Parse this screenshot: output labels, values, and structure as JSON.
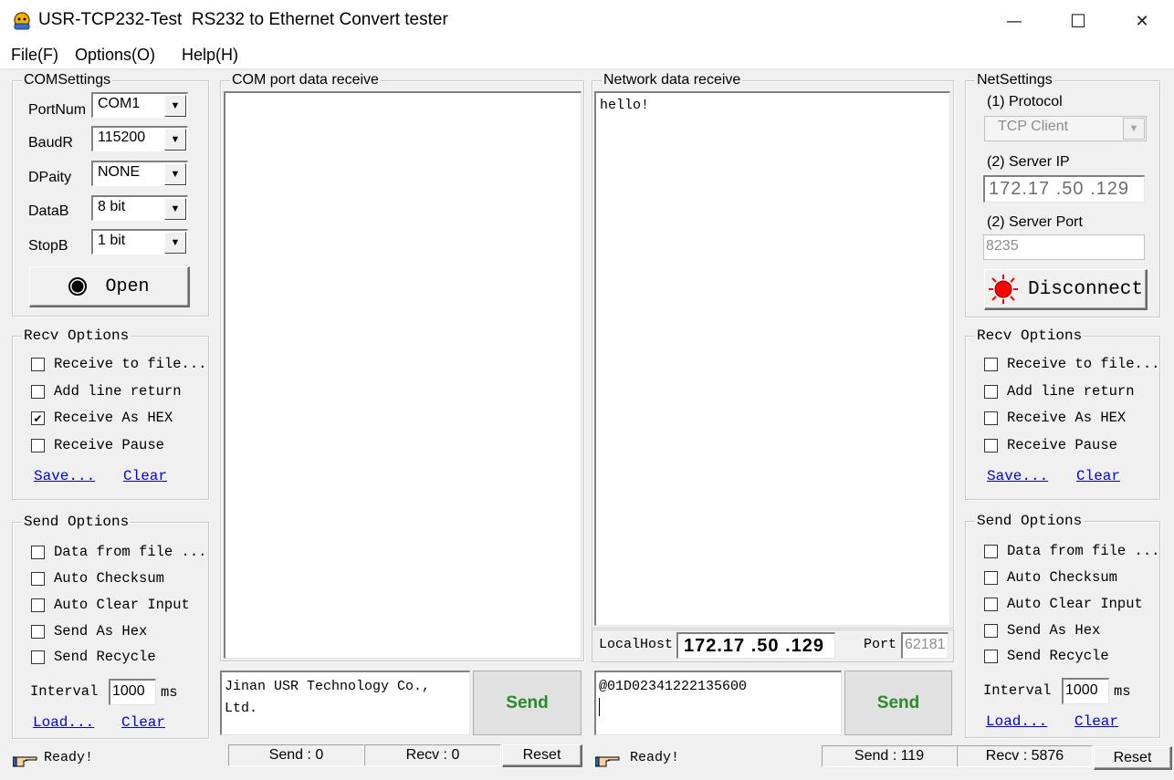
{
  "window": {
    "title": "USR-TCP232-Test  RS232 to Ethernet Convert tester",
    "app_icon": "usr-app-icon",
    "minimize_glyph": "—",
    "maximize_glyph": "☐",
    "close_glyph": "✕"
  },
  "menu": {
    "file": "File(F)",
    "options": "Options(O)",
    "help": "Help(H)"
  },
  "com_settings": {
    "title": "COMSettings",
    "portnum_label": "PortNum",
    "portnum_value": "COM1",
    "baudr_label": "BaudR",
    "baudr_value": "115200",
    "dpaity_label": "DPaity",
    "dpaity_value": "NONE",
    "datab_label": "DataB",
    "datab_value": "8 bit",
    "stopb_label": "StopB",
    "stopb_value": "1 bit",
    "open_button": "Open"
  },
  "left_recv_options": {
    "title": "Recv Options",
    "receive_to_file": "Receive to file...",
    "receive_to_file_checked": false,
    "add_line_return": "Add line return",
    "add_line_return_checked": false,
    "receive_as_hex": "Receive As HEX",
    "receive_as_hex_checked": true,
    "receive_pause": "Receive Pause",
    "receive_pause_checked": false,
    "save_link": "Save...",
    "clear_link": "Clear"
  },
  "left_send_options": {
    "title": "Send Options",
    "data_from_file": "Data from file ...",
    "auto_checksum": "Auto Checksum",
    "auto_clear_input": "Auto Clear Input",
    "send_as_hex": "Send As Hex",
    "send_recycle": "Send Recycle",
    "interval_label": "Interval",
    "interval_value": "1000",
    "interval_unit": "ms",
    "load_link": "Load...",
    "clear_link": "Clear"
  },
  "com_receive": {
    "title": "COM port data receive",
    "content": ""
  },
  "com_send": {
    "input_value": "Jinan USR Technology Co., Ltd.",
    "send_button": "Send"
  },
  "net_receive": {
    "title": "Network data receive",
    "content": "hello!"
  },
  "net_local": {
    "localhost_label": "LocalHost",
    "localhost_value": "172.17 .50 .129",
    "port_label": "Port",
    "port_value": "62181"
  },
  "net_send": {
    "input_value": "@01D02341222135600",
    "send_button": "Send"
  },
  "net_settings": {
    "title": "NetSettings",
    "protocol_label": "(1) Protocol",
    "protocol_value": "TCP Client",
    "server_ip_label": "(2) Server IP",
    "server_ip_value": "172.17 .50 .129",
    "server_port_label": "(2) Server Port",
    "server_port_value": "8235",
    "disconnect_button": "Disconnect"
  },
  "right_recv_options": {
    "title": "Recv Options",
    "receive_to_file": "Receive to file...",
    "add_line_return": "Add line return",
    "receive_as_hex": "Receive As HEX",
    "receive_pause": "Receive Pause",
    "save_link": "Save...",
    "clear_link": "Clear"
  },
  "right_send_options": {
    "title": "Send Options",
    "data_from_file": "Data from file ...",
    "auto_checksum": "Auto Checksum",
    "auto_clear_input": "Auto Clear Input",
    "send_as_hex": "Send As Hex",
    "send_recycle": "Send Recycle",
    "interval_label": "Interval",
    "interval_value": "1000",
    "interval_unit": "ms",
    "load_link": "Load...",
    "clear_link": "Clear"
  },
  "status_left": {
    "ready": "Ready!",
    "send": "Send : 0",
    "recv": "Recv : 0",
    "reset": "Reset"
  },
  "status_right": {
    "ready": "Ready!",
    "send": "Send : 119",
    "recv": "Recv : 5876",
    "reset": "Reset"
  },
  "colors": {
    "send_button_text": "#2a8a2a",
    "link": "#0000ee",
    "disconnect_icon": "#ff0000",
    "window_bg": "#f0f0f0"
  }
}
